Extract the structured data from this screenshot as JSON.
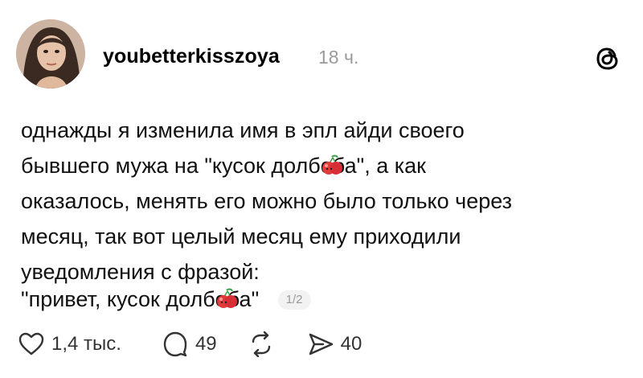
{
  "post": {
    "username": "youbetterkisszoya",
    "time": "18 ч.",
    "text_lines": [
      [
        "однажды я изменила имя в эпл айди своего"
      ],
      [
        "бывшего мужа на \"кусок долбо",
        "ба\", а как"
      ],
      [
        "оказалось, менять его можно было только через"
      ],
      [
        "месяц, так вот целый месяц ему приходили"
      ],
      [
        "уведомления с фразой:"
      ]
    ],
    "quote": [
      "\"привет, кусок долбо",
      "ба\""
    ],
    "page_indicator": "1/2"
  },
  "actions": {
    "likes": "1,4 тыс.",
    "comments": "49",
    "shares": "40"
  },
  "icons": {
    "avatar": "user-avatar",
    "threads": "threads-logo-icon",
    "emoji": "cherry-emoji-icon",
    "like": "heart-icon",
    "comment": "comment-bubble-icon",
    "repost": "repost-icon",
    "share": "send-icon"
  }
}
